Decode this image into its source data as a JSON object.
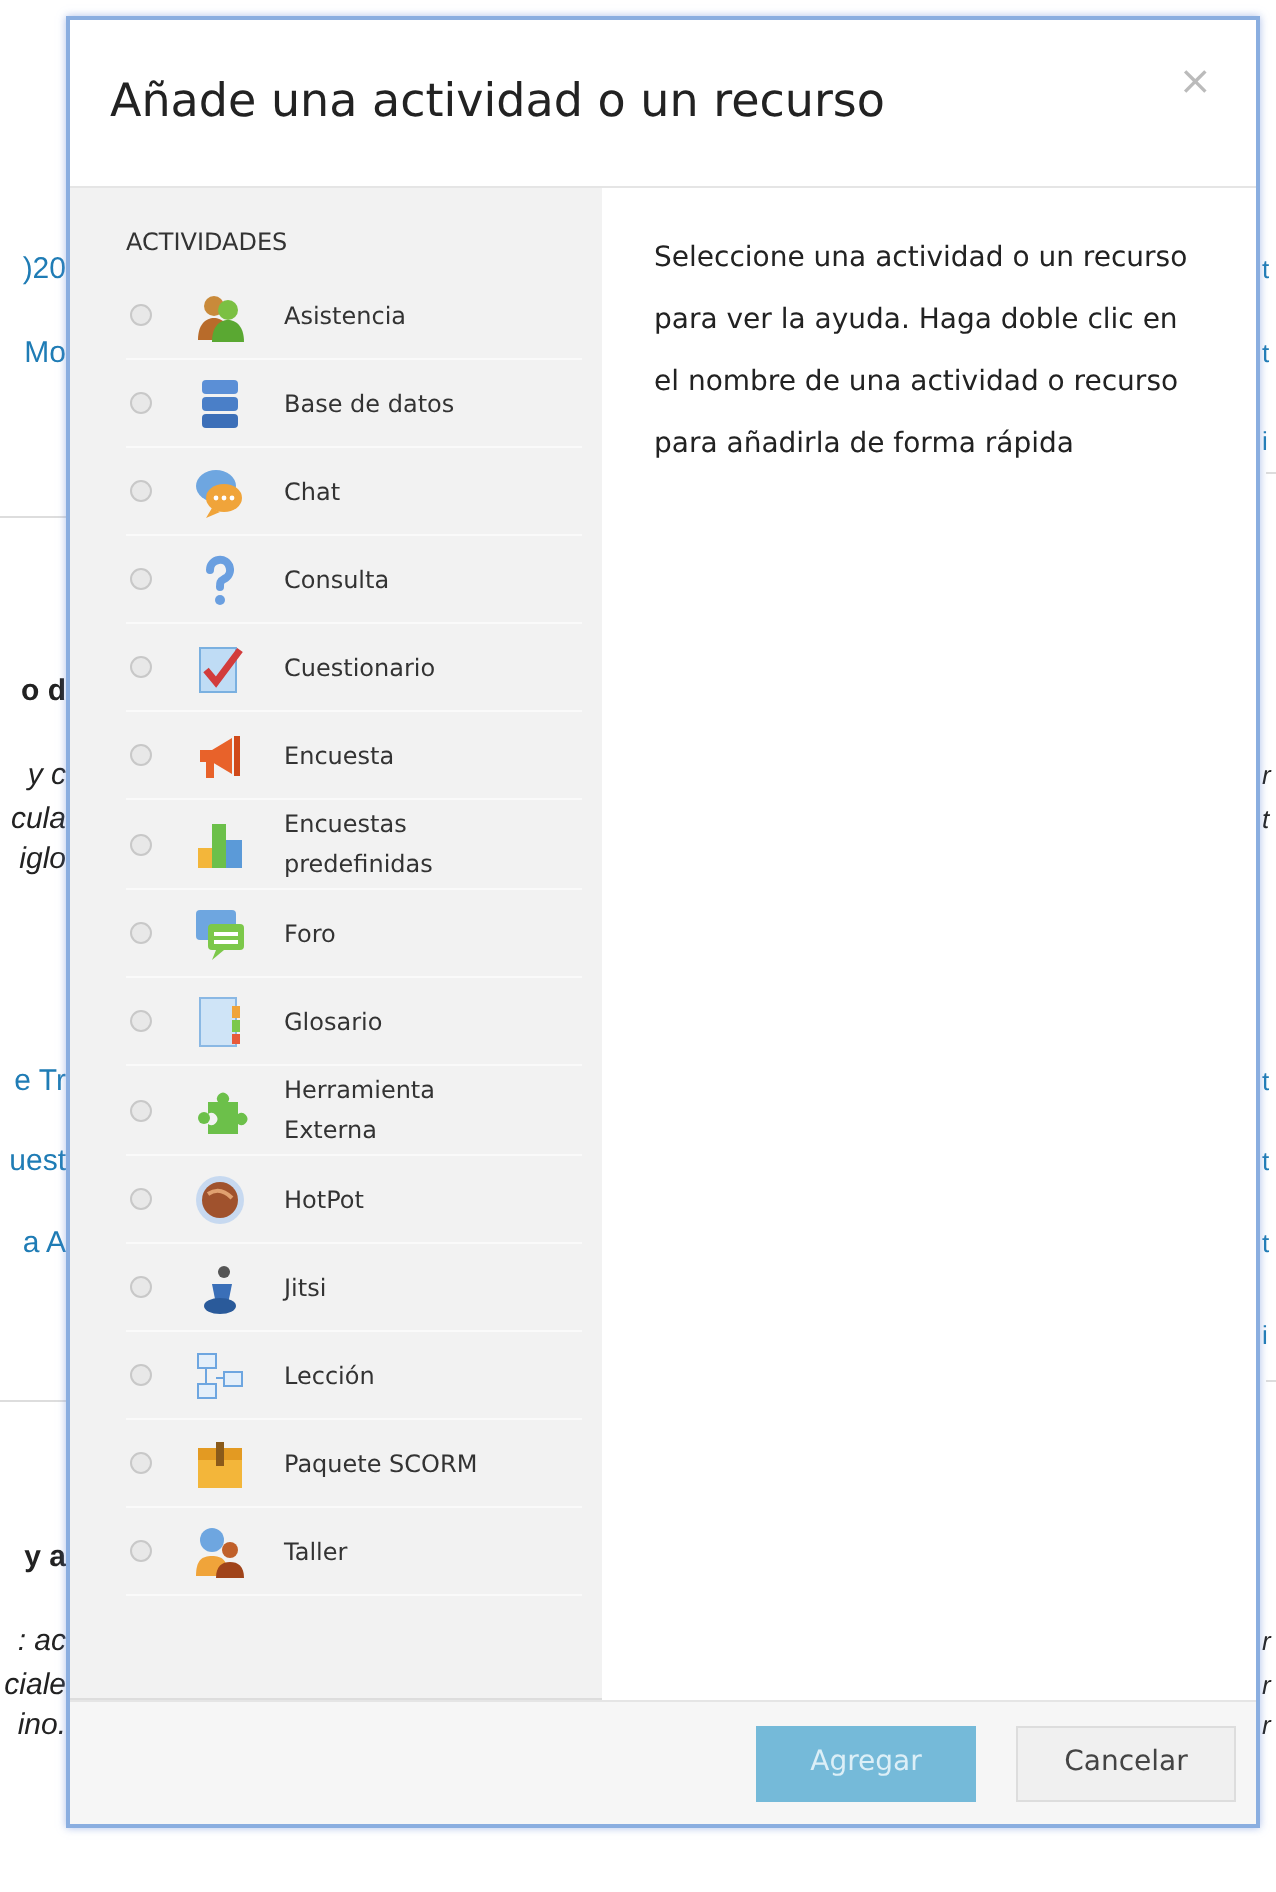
{
  "background_page": {
    "left_fragments": [
      {
        "text": ")20",
        "kind": "link"
      },
      {
        "text": "Mo",
        "kind": "link"
      },
      {
        "text": "o d",
        "kind": "heading"
      },
      {
        "text": "y c",
        "kind": "italic"
      },
      {
        "text": "cula",
        "kind": "italic"
      },
      {
        "text": "iglo",
        "kind": "italic"
      },
      {
        "text": "e Tr",
        "kind": "link"
      },
      {
        "text": "uest",
        "kind": "link"
      },
      {
        "text": "a A",
        "kind": "link"
      },
      {
        "text": "y a",
        "kind": "heading"
      },
      {
        "text": ": ac",
        "kind": "italic"
      },
      {
        "text": "ciale",
        "kind": "italic"
      },
      {
        "text": "ino.",
        "kind": "italic"
      }
    ],
    "right_fragments": [
      {
        "text": "t",
        "kind": "link"
      },
      {
        "text": "t",
        "kind": "link"
      },
      {
        "text": "i",
        "kind": "link"
      },
      {
        "text": "r",
        "kind": "italic"
      },
      {
        "text": "t",
        "kind": "italic"
      },
      {
        "text": "t",
        "kind": "link"
      },
      {
        "text": "t",
        "kind": "link"
      },
      {
        "text": "t",
        "kind": "link"
      },
      {
        "text": "i",
        "kind": "link"
      },
      {
        "text": "r",
        "kind": "italic"
      },
      {
        "text": "r",
        "kind": "italic"
      },
      {
        "text": "r",
        "kind": "italic"
      }
    ]
  },
  "dialog": {
    "title": "Añade una actividad o un recurso",
    "close": "×",
    "section_heading": "ACTIVIDADES",
    "items": [
      {
        "label": "Asistencia",
        "selected": false
      },
      {
        "label": "Base de datos",
        "selected": false
      },
      {
        "label": "Chat",
        "selected": false
      },
      {
        "label": "Consulta",
        "selected": false
      },
      {
        "label": "Cuestionario",
        "selected": false
      },
      {
        "label": "Encuesta",
        "selected": false
      },
      {
        "label": "Encuestas predefinidas",
        "selected": false
      },
      {
        "label": "Foro",
        "selected": false
      },
      {
        "label": "Glosario",
        "selected": false
      },
      {
        "label": "Herramienta Externa",
        "selected": false
      },
      {
        "label": "HotPot",
        "selected": false
      },
      {
        "label": "Jitsi",
        "selected": false
      },
      {
        "label": "Lección",
        "selected": false
      },
      {
        "label": "Paquete SCORM",
        "selected": false
      },
      {
        "label": "Taller",
        "selected": false
      }
    ],
    "help_text": "Seleccione una actividad o un recurso para ver la ayuda. Haga doble clic en el nombre de una actividad o recurso para añadirla de forma rápida",
    "buttons": [
      {
        "label": "Agregar",
        "kind": "primary",
        "disabled": true
      },
      {
        "label": "Cancelar",
        "kind": "secondary",
        "disabled": false
      }
    ]
  }
}
